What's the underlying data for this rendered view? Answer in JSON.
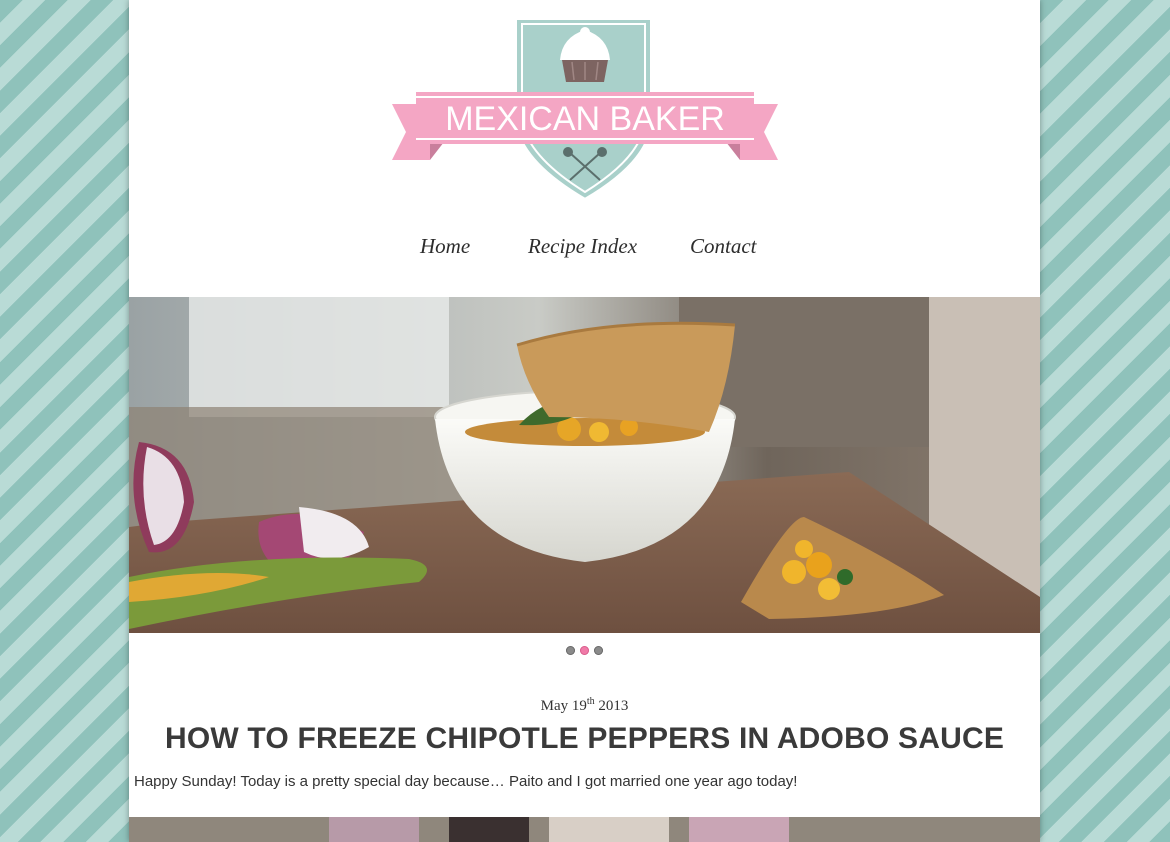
{
  "brand": {
    "name": "MEXICAN BAKER"
  },
  "nav": {
    "home": "Home",
    "recipe_index": "Recipe Index",
    "contact": "Contact"
  },
  "slider": {
    "slide_count": 3,
    "active_slide": 2
  },
  "post": {
    "date_prefix": "May 19",
    "date_suffix": "th",
    "date_year": "2013",
    "title": "HOW TO FREEZE CHIPOTLE PEPPERS IN ADOBO SAUCE",
    "excerpt": "Happy Sunday! Today is a pretty special day because… Paito and I got married one year ago today!"
  },
  "colors": {
    "stripe_dark": "#8fc2bb",
    "stripe_light": "#b9dbd6",
    "ribbon_pink": "#f4a6c4",
    "shield_teal": "#a9d0ca",
    "dot_active": "#f07aa8"
  }
}
